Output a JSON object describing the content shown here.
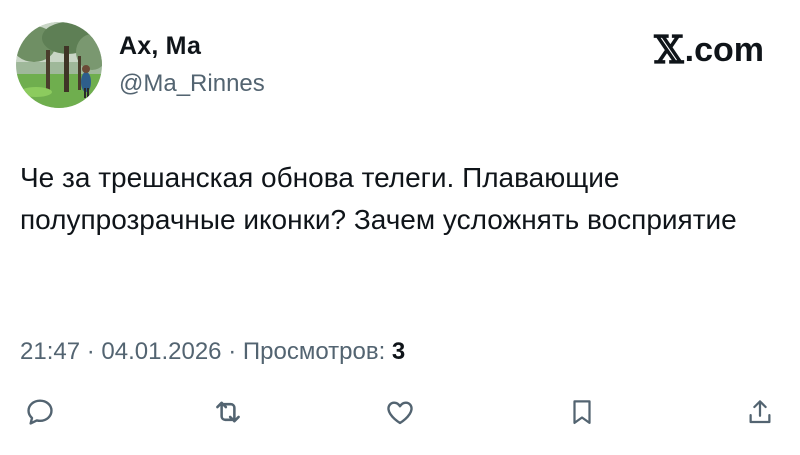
{
  "tweet": {
    "author": {
      "display_name": "Ах, Ма",
      "handle": "@Ma_Rinnes"
    },
    "brand": {
      "symbol": "𝕏",
      "domain": ".com"
    },
    "text": "Че за трешанская обнова телеги. Плавающие полупрозрачные иконки? Зачем усложнять восприятие",
    "meta": {
      "time": "21:47",
      "separator": "·",
      "date": "04.01.2026",
      "views_label": "Просмотров:",
      "views_count": "3"
    },
    "actions": [
      {
        "name": "reply",
        "icon": "reply-icon"
      },
      {
        "name": "retweet",
        "icon": "retweet-icon"
      },
      {
        "name": "like",
        "icon": "heart-icon"
      },
      {
        "name": "bookmark",
        "icon": "bookmark-icon"
      },
      {
        "name": "share",
        "icon": "share-icon"
      }
    ],
    "colors": {
      "text": "#0f1419",
      "secondary": "#536471",
      "icon": "#536471"
    }
  }
}
